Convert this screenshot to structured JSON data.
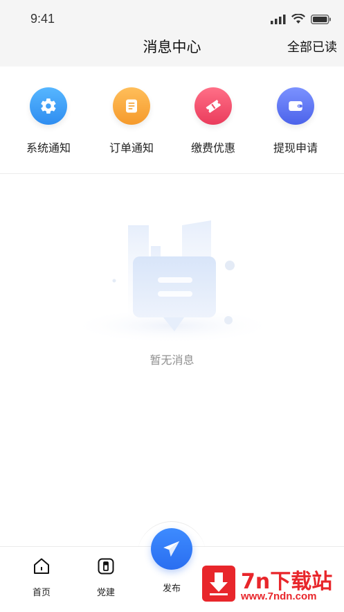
{
  "status_bar": {
    "time": "9:41"
  },
  "header": {
    "title": "消息中心",
    "mark_all_read": "全部已读"
  },
  "categories": [
    {
      "label": "系统通知",
      "icon": "gear-icon",
      "color": "#3c9cf5"
    },
    {
      "label": "订单通知",
      "icon": "document-icon",
      "color": "#f7a23a"
    },
    {
      "label": "缴费优惠",
      "icon": "coupon-icon",
      "color": "#f0506a"
    },
    {
      "label": "提现申请",
      "icon": "wallet-icon",
      "color": "#5a72f0"
    }
  ],
  "empty_state": {
    "message": "暂无消息"
  },
  "tabbar": {
    "tabs": [
      {
        "label": "首页",
        "icon": "home-icon"
      },
      {
        "label": "党建",
        "icon": "party-building-icon"
      }
    ],
    "publish": {
      "label": "发布",
      "icon": "paper-plane-icon",
      "color": "#2f7bf6"
    }
  },
  "watermark": {
    "title": "7n下载站",
    "url": "www.7ndn.com",
    "color": "#e8262b"
  }
}
